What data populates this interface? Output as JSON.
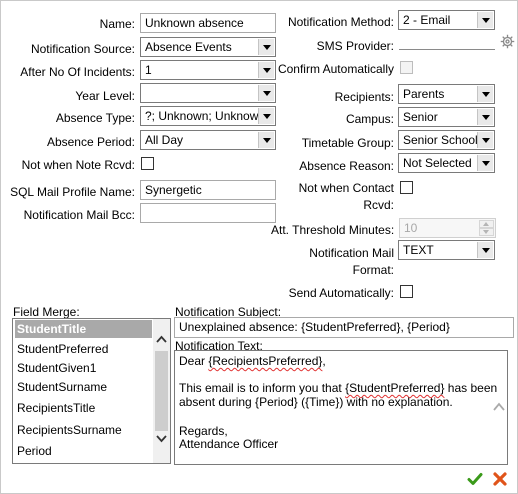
{
  "left_fields": {
    "name": {
      "label": "Name:",
      "value": "Unknown absence"
    },
    "notification_source": {
      "label": "Notification Source:",
      "value": "Absence Events"
    },
    "after_no_incidents": {
      "label": "After No Of Incidents:",
      "value": "1"
    },
    "year_level": {
      "label": "Year Level:",
      "value": ""
    },
    "absence_type": {
      "label": "Absence Type:",
      "value": "?; Unknown; Unknown"
    },
    "absence_period": {
      "label": "Absence Period:",
      "value": "All Day"
    },
    "not_when_note_rcvd": {
      "label": "Not when Note Rcvd:",
      "checked": false
    },
    "sql_mail_profile": {
      "label": "SQL Mail Profile Name:",
      "value": "Synergetic"
    },
    "notification_mail_bcc": {
      "label": "Notification Mail Bcc:",
      "value": ""
    }
  },
  "right_fields": {
    "notification_method": {
      "label": "Notification Method:",
      "value": "2 - Email"
    },
    "sms_provider": {
      "label": "SMS Provider:",
      "value": "",
      "icon": "gear-icon"
    },
    "confirm_automatically": {
      "label": "Confirm Automatically",
      "checked": false,
      "disabled": true
    },
    "recipients": {
      "label": "Recipients:",
      "value": "Parents"
    },
    "campus": {
      "label": "Campus:",
      "value": "Senior"
    },
    "timetable_group": {
      "label": "Timetable Group:",
      "value": "Senior School"
    },
    "absence_reason": {
      "label": "Absence Reason:",
      "value": "Not Selected"
    },
    "not_when_contact_rcvd": {
      "label_line1": "Not when Contact",
      "label_line2": "Rcvd:",
      "checked": false
    },
    "att_threshold_minutes": {
      "label": "Att. Threshold Minutes:",
      "value": "10",
      "disabled": true
    },
    "notification_mail_format": {
      "label_line1": "Notification Mail",
      "label_line2": "Format:",
      "value": "TEXT"
    },
    "send_automatically": {
      "label": "Send Automatically:",
      "checked": false
    }
  },
  "field_merge": {
    "label": "Field Merge:",
    "selected": "StudentTitle",
    "items": [
      "StudentTitle",
      "StudentPreferred",
      "StudentGiven1",
      "StudentSurname",
      "RecipientsTitle",
      "RecipientsSurname",
      "Period"
    ]
  },
  "notification_subject": {
    "label": "Notification Subject:",
    "value": "Unexplained absence: {StudentPreferred}, {Period}"
  },
  "notification_text": {
    "label": "Notification Text:",
    "line1_a": "Dear ",
    "line1_b": "{RecipientsPreferred}",
    "line1_c": ",",
    "line2_a": "This email is to inform you that ",
    "line2_b": "{StudentPreferred}",
    "line2_c": " has been",
    "line3": "absent during {Period} ({Time}) with no explanation.",
    "line4": "Regards,",
    "line5": "Attendance Officer"
  },
  "actions": {
    "confirm_icon": "check-icon",
    "cancel_icon": "close-icon",
    "confirm_color": "#3a9a1a",
    "cancel_color": "#e0541a"
  }
}
